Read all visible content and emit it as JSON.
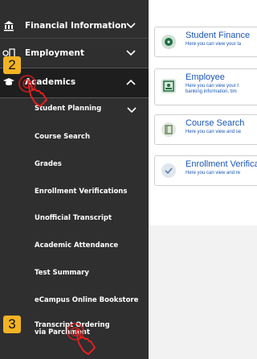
{
  "sidebar": {
    "top_items": [
      {
        "label": "Financial Information",
        "icon": "bank-icon"
      },
      {
        "label": "Employment",
        "icon": "id-card-icon"
      },
      {
        "label": "Academics",
        "icon": "graduation-cap-icon"
      }
    ],
    "sub_items": [
      "Student Planning",
      "Course Search",
      "Grades",
      "Enrollment Verifications",
      "Unofficial Transcript",
      "Academic Attendance",
      "Test Summary",
      "eCampus Online Bookstore",
      "Transcript Ordering via Parchment"
    ]
  },
  "cards": [
    {
      "title": "Student Finance",
      "desc": "Here you can view your la"
    },
    {
      "title": "Employee",
      "desc": "Here you can view your t\nbanking information, tim"
    },
    {
      "title": "Course Search",
      "desc": "Here you can view and se"
    },
    {
      "title": "Enrollment Verifica",
      "desc": "Here you can view and re"
    }
  ],
  "annotations": {
    "step2": "2",
    "step3": "3"
  },
  "colors": {
    "sidebar": "#2f2f2f",
    "badge": "#f2b324",
    "link": "#1a56b8"
  }
}
